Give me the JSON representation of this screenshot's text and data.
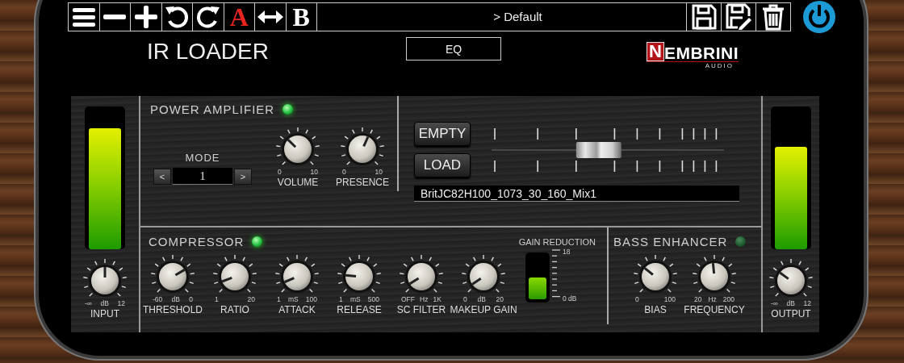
{
  "toolbar": {
    "buttons": [
      {
        "kind": "menu"
      },
      {
        "kind": "minus"
      },
      {
        "kind": "plus"
      },
      {
        "kind": "undo"
      },
      {
        "kind": "redo"
      },
      {
        "kind": "text",
        "label": "A",
        "color": "#e8241e"
      },
      {
        "kind": "swap"
      },
      {
        "kind": "text",
        "label": "B",
        "color": "#ffffff"
      }
    ],
    "preset": "> Default",
    "file_buttons": [
      {
        "kind": "save"
      },
      {
        "kind": "save-as"
      },
      {
        "kind": "delete"
      }
    ],
    "power": {
      "on": true
    }
  },
  "title": "IR LOADER",
  "eq_button": "EQ",
  "logo": {
    "initial": "N",
    "rest": "EMBRINI",
    "sub": "AUDIO"
  },
  "input": {
    "meter": {
      "level": 0.85
    },
    "knob": {
      "label": "INPUT",
      "min": "-∞",
      "unit": "dB",
      "max": "12",
      "level": 0.5
    }
  },
  "power_amplifier": {
    "title": "POWER AMPLIFIER",
    "led": {
      "on": true
    },
    "mode": {
      "label": "MODE",
      "prev": "<",
      "value": "1",
      "next": ">"
    },
    "knobs": [
      {
        "label": "VOLUME",
        "min": "0",
        "max": "10",
        "level": 0.33
      },
      {
        "label": "PRESENCE",
        "min": "0",
        "max": "10",
        "level": 0.59
      }
    ],
    "ir_buttons": [
      "EMPTY",
      "LOAD"
    ],
    "fader": {
      "level": 0.46
    },
    "ir_file": "BritJC82H100_1073_30_160_Mix1"
  },
  "compressor": {
    "title": "COMPRESSOR",
    "led": {
      "on": true
    },
    "knobs": [
      {
        "label": "THRESHOLD",
        "min": "-60",
        "unit": "dB",
        "max": "0",
        "level": 0.72
      },
      {
        "label": "RATIO",
        "min": "1",
        "max": "20",
        "level": 0.09
      },
      {
        "label": "ATTACK",
        "min": "1",
        "unit": "mS",
        "max": "100",
        "level": 0.08
      },
      {
        "label": "RELEASE",
        "min": "1",
        "unit": "mS",
        "max": "500",
        "level": 0.19
      },
      {
        "label": "SC FILTER",
        "min": "OFF",
        "unit": "Hz",
        "max": "1K",
        "level": 0.05
      },
      {
        "label": "MAKEUP GAIN",
        "min": "0",
        "unit": "dB",
        "max": "20",
        "level": 0.04
      }
    ],
    "gain_reduction": {
      "label": "GAIN REDUCTION",
      "max": "18",
      "min": "0 dB",
      "level": 0.5
    }
  },
  "bass_enhancer": {
    "title": "BASS ENHANCER",
    "led": {
      "on": false
    },
    "knobs": [
      {
        "label": "BIAS",
        "min": "0",
        "max": "100",
        "level": 0.31
      },
      {
        "label": "FREQUENCY",
        "min": "20",
        "unit": "Hz",
        "max": "200",
        "level": 0.48
      }
    ]
  },
  "output": {
    "meter": {
      "level": 0.72
    },
    "knob": {
      "label": "OUTPUT",
      "min": "-∞",
      "unit": "dB",
      "max": "12",
      "level": 0.3
    }
  }
}
